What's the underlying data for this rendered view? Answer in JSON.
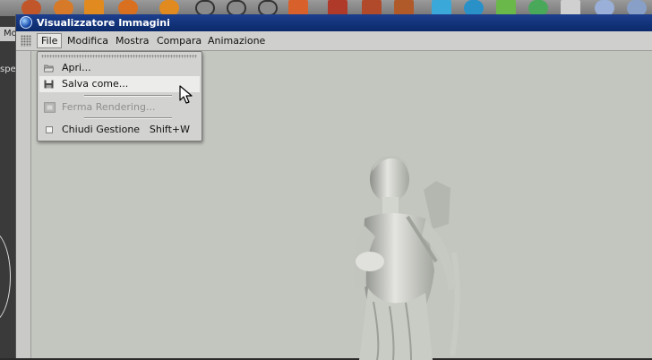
{
  "window": {
    "title": "Visualizzatore Immagini"
  },
  "menubar": {
    "items": [
      {
        "label": "File"
      },
      {
        "label": "Modifica"
      },
      {
        "label": "Mostra"
      },
      {
        "label": "Compara"
      },
      {
        "label": "Animazione"
      }
    ]
  },
  "file_menu": {
    "items": [
      {
        "label": "Apri...",
        "icon": "folder-open-icon",
        "enabled": true
      },
      {
        "label": "Salva come...",
        "icon": "floppy-disk-icon",
        "enabled": true,
        "highlighted": true
      },
      {
        "label": "Ferma Rendering...",
        "icon": "stop-render-icon",
        "enabled": false
      },
      {
        "label": "Chiudi Gestione",
        "shortcut": "Shift+W",
        "icon": "window-icon",
        "enabled": true
      }
    ]
  },
  "background_app": {
    "tab_label": "Mo",
    "side_label": "spe"
  },
  "colors": {
    "titlebar": "#0c2a6a",
    "viewport": "#c3c5bf",
    "menu_bg": "#d2d2d0"
  }
}
